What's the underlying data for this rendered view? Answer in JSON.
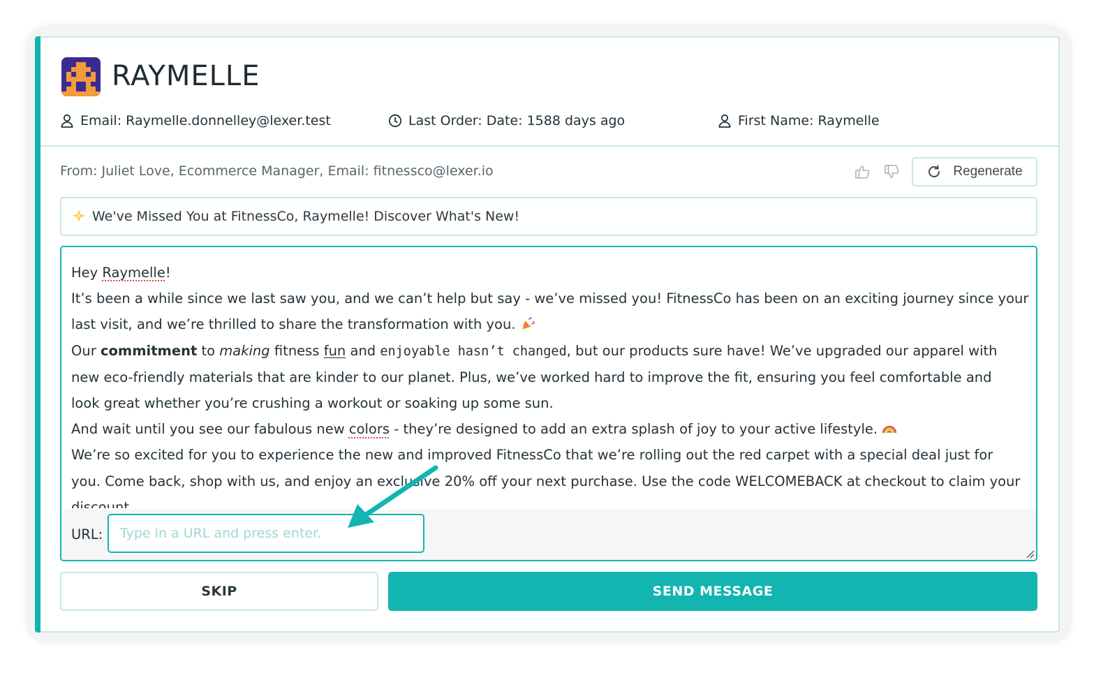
{
  "customer": {
    "name": "RAYMELLE",
    "email": "Email: Raymelle.donnelley@lexer.test",
    "last_order": "Last Order: Date: 1588 days ago",
    "first_name": "First Name: Raymelle"
  },
  "sender": {
    "from": "From: Juliet Love, Ecommerce Manager, Email: fitnessco@lexer.io"
  },
  "actions": {
    "regenerate_label": "Regenerate",
    "skip_label": "SKIP",
    "send_label": "SEND MESSAGE"
  },
  "subject": "We've Missed You at FitnessCo, Raymelle! Discover What's New!",
  "message": {
    "greeting_pre": "Hey ",
    "greeting_name": "Raymelle",
    "greeting_post": "!",
    "p1_l1": "It’s been a while since we last saw you, and we can’t help but say - we’ve missed you! FitnessCo has been on an exciting journey since your",
    "p1_l2": "last visit, and we’re thrilled to share the transformation with you. ",
    "p2_a": "Our ",
    "p2_bold": "commitment",
    "p2_b": " to ",
    "p2_italic": "making",
    "p2_c": " fitness ",
    "p2_under": "fun",
    "p2_d": " and ",
    "p2_code": "enjoyable hasn’t changed",
    "p2_e": ", but our products sure have! We’ve upgraded our apparel with",
    "p2_l2": "new eco-friendly materials that are kinder to our planet. Plus, we’ve worked hard to improve the fit, ensuring you feel comfortable and",
    "p2_l3": "look great whether you’re crushing a workout or soaking up some sun.",
    "p3_a": "And wait until you see our fabulous new ",
    "p3_word": "colors",
    "p3_b": " - they’re designed to add an extra splash of joy to your active lifestyle. ",
    "p4_l1": "We’re so excited for you to experience the new and improved FitnessCo that we’re rolling out the red carpet with a special deal just for",
    "p4_l2": "you. Come back, shop with us, and enjoy an exclusive 20% off your next purchase. Use the code WELCOMEBACK at checkout to claim your",
    "p4_l3": "discount."
  },
  "url_field": {
    "label": "URL:",
    "placeholder": "Type in a URL and press enter.",
    "value": ""
  },
  "icons": {
    "email": "user-icon",
    "last_order": "clock-icon",
    "first_name": "user-icon",
    "thumbs_up": "thumbs-up-icon",
    "thumbs_down": "thumbs-down-icon",
    "regenerate": "refresh-icon",
    "subject": "sparkle-icon",
    "party": "party-popper-icon",
    "rainbow": "rainbow-icon"
  },
  "colors": {
    "accent": "#12b5b0",
    "border": "#c9e7e6",
    "logo_bg": "#3b2a93"
  }
}
